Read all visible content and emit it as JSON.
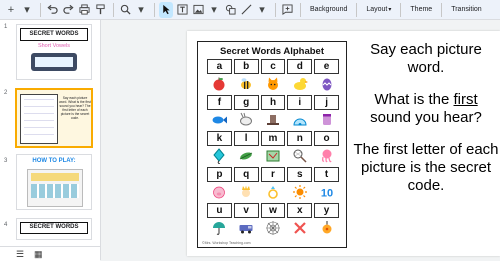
{
  "toolbar": {
    "add_icon": "+",
    "caret": "▾",
    "background_label": "Background",
    "layout_label": "Layout",
    "theme_label": "Theme",
    "transition_label": "Transition"
  },
  "thumbnails": [
    {
      "number": "1",
      "title": "SECRET WORDS",
      "subtitle": "Short Vowels"
    },
    {
      "number": "2",
      "text": "Say each picture word. What is the first sound you hear? The first letter of each picture is the secret code."
    },
    {
      "number": "3",
      "title": "HOW TO PLAY:"
    },
    {
      "number": "4",
      "title": "SECRET WORDS"
    }
  ],
  "worksheet": {
    "title": "Secret Words Alphabet",
    "rows": [
      {
        "letters": [
          "a",
          "b",
          "c",
          "d",
          "e"
        ],
        "pics": [
          "apple",
          "bee",
          "cat",
          "duck",
          "egg"
        ]
      },
      {
        "letters": [
          "f",
          "g",
          "h",
          "i",
          "j"
        ],
        "pics": [
          "fish",
          "goat",
          "hat",
          "igloo",
          "jelly"
        ]
      },
      {
        "letters": [
          "k",
          "l",
          "m",
          "n",
          "o"
        ],
        "pics": [
          "kite",
          "leaf",
          "map",
          "net",
          "octopus"
        ]
      },
      {
        "letters": [
          "p",
          "q",
          "r",
          "s",
          "t"
        ],
        "pics": [
          "pig",
          "queen",
          "ring",
          "sun",
          "ten"
        ]
      },
      {
        "letters": [
          "u",
          "v",
          "w",
          "x",
          "y"
        ],
        "pics": [
          "umbrella",
          "van",
          "web",
          "x",
          "yoyo"
        ]
      }
    ],
    "footer": "©Mrs. Workshop Teaching.com"
  },
  "instructions": {
    "p1": "Say each picture word.",
    "p2_before": "What is the",
    "p2_underline": "first",
    "p2_after": "sound you hear?",
    "p3": "The first letter of each picture is the secret code."
  }
}
